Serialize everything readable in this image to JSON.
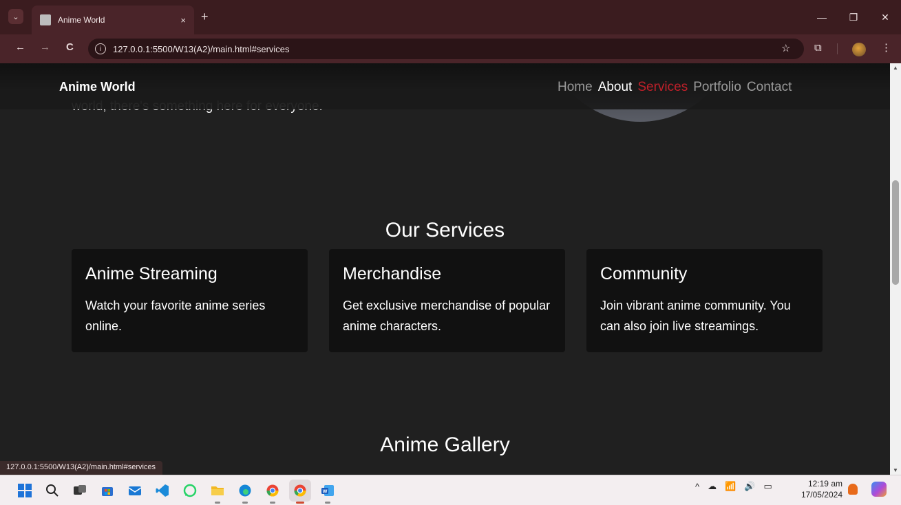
{
  "browser": {
    "tab_title": "Anime World",
    "tab_close": "×",
    "new_tab": "+",
    "tab_dropdown": "⌄",
    "url": "127.0.0.1:5500/W13(A2)/main.html#services",
    "status_url": "127.0.0.1:5500/W13(A2)/main.html#services",
    "window_controls": {
      "minimize": "—",
      "restore": "❐",
      "close": "✕"
    },
    "nav": {
      "back": "←",
      "forward": "→",
      "reload": "C"
    }
  },
  "site": {
    "brand": "Anime World",
    "nav_links": {
      "home": "Home",
      "about": "About",
      "services": "Services",
      "portfolio": "Portfolio",
      "contact": "Contact"
    },
    "hero_fragment": "world, there's something here for everyone.",
    "services": {
      "title": "Our Services",
      "cards": [
        {
          "title": "Anime Streaming",
          "text": "Watch your favorite anime series online."
        },
        {
          "title": "Merchandise",
          "text": "Get exclusive merchandise of popular anime characters."
        },
        {
          "title": "Community",
          "text": "Join vibrant anime community. You can also join live streamings."
        }
      ]
    },
    "gallery": {
      "title": "Anime Gallery"
    },
    "colors": {
      "accent": "#c0202a",
      "background": "#202020",
      "card": "#111111"
    }
  },
  "taskbar": {
    "apps": [
      "windows-start",
      "search",
      "task-view",
      "microsoft-store",
      "mail",
      "vscode",
      "whatsapp",
      "file-explorer",
      "edge",
      "chrome",
      "chrome-active",
      "word"
    ],
    "tray": {
      "chevron": "^"
    },
    "clock": {
      "time": "12:19 am",
      "date": "17/05/2024"
    }
  }
}
